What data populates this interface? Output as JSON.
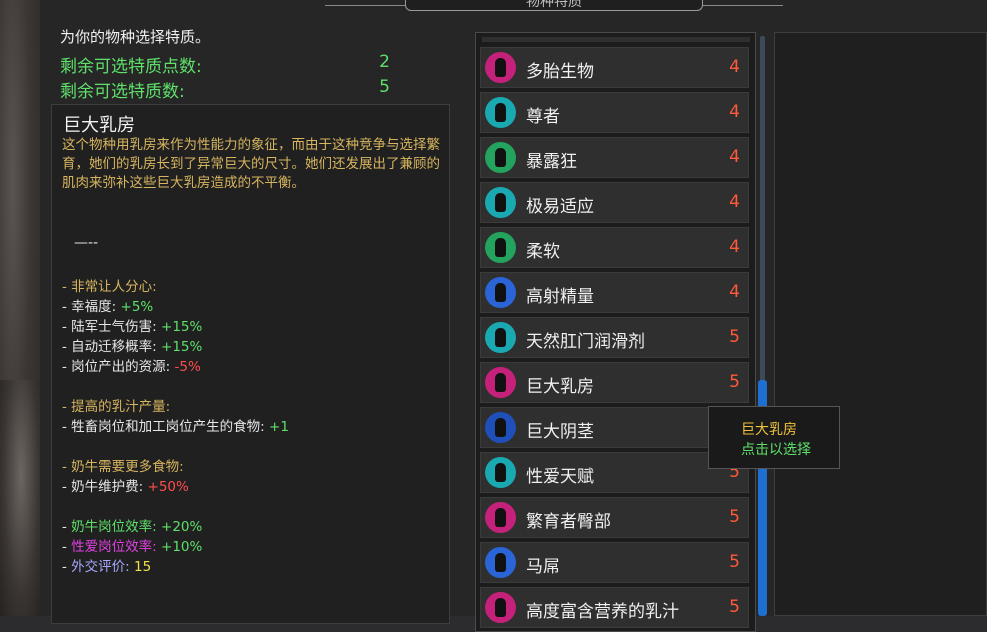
{
  "window": {
    "panel_title": "物种特质"
  },
  "header": {
    "intro": "为你的物种选择特质。",
    "remaining_points_label": "剩余可选特质点数:",
    "remaining_points_value": "2",
    "remaining_count_label": "剩余可选特质数:",
    "remaining_count_value": "5"
  },
  "detail": {
    "title": "巨大乳房",
    "description": "这个物种用乳房来作为性能力的象征，而由于这种竞争与选择繁育，她们的乳房长到了异常巨大的尺寸。她们还发展出了兼顾的肌肉来弥补这些巨大乳房造成的不平衡。",
    "divider": "—--",
    "effects": [
      {
        "label": "- 非常让人分心:",
        "value": ""
      },
      {
        "label": " - 幸福度: ",
        "value": "+5%"
      },
      {
        "label": " - 陆军士气伤害: ",
        "value": "+15%"
      },
      {
        "label": " - 自动迁移概率: ",
        "value": "+15%"
      },
      {
        "label": " - 岗位产出的资源: ",
        "value": "-5%"
      },
      {
        "label": "- 提高的乳汁产量:",
        "value": ""
      },
      {
        "label": " - 牲畜岗位和加工岗位产生的食物: ",
        "value": "+1"
      },
      {
        "label": "- 奶牛需要更多食物:",
        "value": ""
      },
      {
        "label": " - 奶牛维护费: ",
        "value": "+50%"
      },
      {
        "label": "奶牛岗位效率: ",
        "value": "+20%"
      },
      {
        "label": "性爱岗位效率: ",
        "value": "+10%"
      },
      {
        "label": "外交评价: ",
        "value": "15"
      }
    ]
  },
  "traits": [
    {
      "name": "多胎生物",
      "cost": "4",
      "icon": "multi-birth-icon",
      "color": "#c4227a"
    },
    {
      "name": "尊者",
      "cost": "4",
      "icon": "elephant-icon",
      "color": "#1aa9b0"
    },
    {
      "name": "暴露狂",
      "cost": "4",
      "icon": "exhibitionist-icon",
      "color": "#24a35e"
    },
    {
      "name": "极易适应",
      "cost": "4",
      "icon": "adaptive-icon",
      "color": "#1aa9b0"
    },
    {
      "name": "柔软",
      "cost": "4",
      "icon": "flexible-icon",
      "color": "#24a35e"
    },
    {
      "name": "高射精量",
      "cost": "4",
      "icon": "high-ejaculation-icon",
      "color": "#2a64d6"
    },
    {
      "name": "天然肛门润滑剂",
      "cost": "5",
      "icon": "lubricant-icon",
      "color": "#1aa9b0"
    },
    {
      "name": "巨大乳房",
      "cost": "5",
      "icon": "large-breasts-icon",
      "color": "#c4227a"
    },
    {
      "name": "巨大阴茎",
      "cost": "5",
      "icon": "large-penis-icon",
      "color": "#1f4fb8"
    },
    {
      "name": "性爱天赋",
      "cost": "5",
      "icon": "sex-talent-icon",
      "color": "#1aa9b0"
    },
    {
      "name": "繁育者臀部",
      "cost": "5",
      "icon": "breeder-hips-icon",
      "color": "#c4227a"
    },
    {
      "name": "马屌",
      "cost": "5",
      "icon": "horse-icon",
      "color": "#2a64d6"
    },
    {
      "name": "高度富含营养的乳汁",
      "cost": "5",
      "icon": "nutritious-milk-icon",
      "color": "#c4227a"
    }
  ],
  "tooltip": {
    "title": "巨大乳房",
    "action": "点击以选择"
  }
}
